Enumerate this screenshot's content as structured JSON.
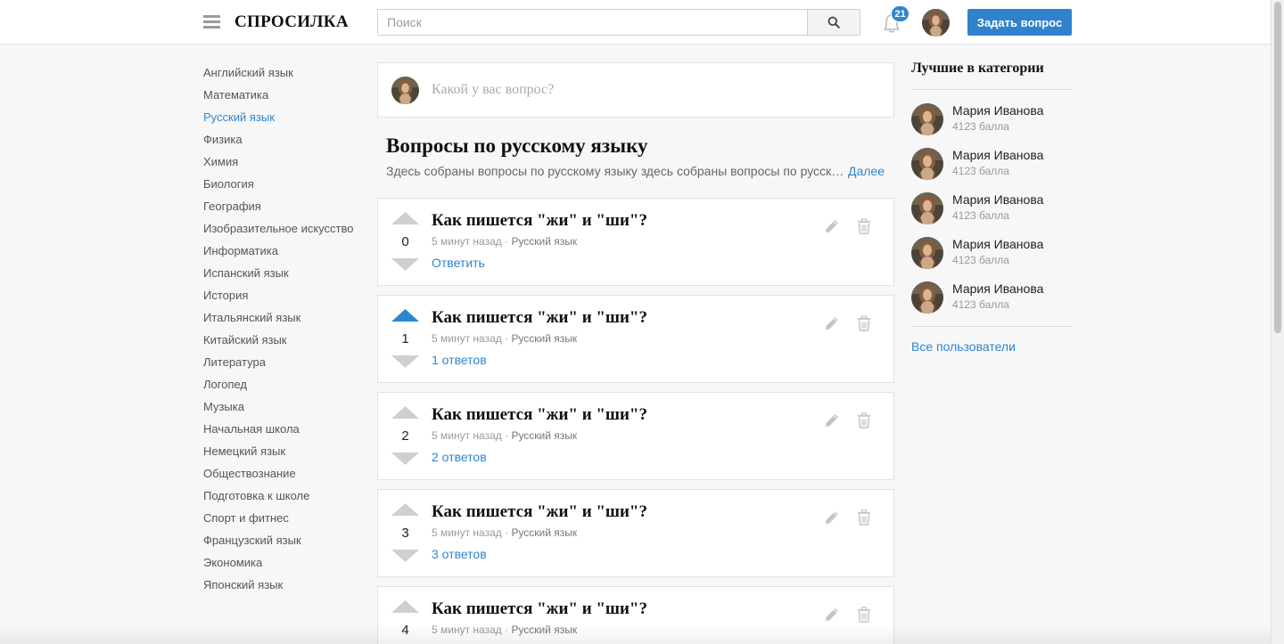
{
  "header": {
    "logo": "СПРОСИЛКА",
    "search_placeholder": "Поиск",
    "notification_count": "21",
    "ask_button": "Задать вопрос"
  },
  "categories": [
    {
      "label": "Английский язык"
    },
    {
      "label": "Математика"
    },
    {
      "label": "Русский язык",
      "active": true
    },
    {
      "label": "Физика"
    },
    {
      "label": "Химия"
    },
    {
      "label": "Биология"
    },
    {
      "label": "География"
    },
    {
      "label": "Изобразительное искусство"
    },
    {
      "label": "Информатика"
    },
    {
      "label": "Испанский язык"
    },
    {
      "label": "История"
    },
    {
      "label": "Итальянский язык"
    },
    {
      "label": "Китайский язык"
    },
    {
      "label": "Литература"
    },
    {
      "label": "Логопед"
    },
    {
      "label": "Музыка"
    },
    {
      "label": "Начальная школа"
    },
    {
      "label": "Немецкий язык"
    },
    {
      "label": "Обществознание"
    },
    {
      "label": "Подготовка к школе"
    },
    {
      "label": "Спорт и фитнес"
    },
    {
      "label": "Французский язык"
    },
    {
      "label": "Экономика"
    },
    {
      "label": "Японский язык"
    }
  ],
  "composer": {
    "placeholder": "Какой у вас вопрос?"
  },
  "main": {
    "title": "Вопросы по русскому языку",
    "description": "Здесь собраны вопросы по русскому языку здесь собраны вопросы по русскому языку",
    "more_link": "Далее"
  },
  "questions": [
    {
      "votes": "0",
      "upvoted": false,
      "title": "Как пишется \"жи\" и \"ши\"?",
      "time": "5 минут назад",
      "category": "Русский язык",
      "answer_link": "Ответить"
    },
    {
      "votes": "1",
      "upvoted": true,
      "title": "Как пишется \"жи\" и \"ши\"?",
      "time": "5 минут назад",
      "category": "Русский язык",
      "answer_link": "1 ответов"
    },
    {
      "votes": "2",
      "upvoted": false,
      "title": "Как пишется \"жи\" и \"ши\"?",
      "time": "5 минут назад",
      "category": "Русский язык",
      "answer_link": "2 ответов"
    },
    {
      "votes": "3",
      "upvoted": false,
      "title": "Как пишется \"жи\" и \"ши\"?",
      "time": "5 минут назад",
      "category": "Русский язык",
      "answer_link": "3 ответов"
    },
    {
      "votes": "4",
      "upvoted": false,
      "title": "Как пишется \"жи\" и \"ши\"?",
      "time": "5 минут назад",
      "category": "Русский язык",
      "answer_link": ""
    }
  ],
  "sidebar_right": {
    "title": "Лучшие в категории",
    "users": [
      {
        "name": "Мария Иванова",
        "points": "4123 балла"
      },
      {
        "name": "Мария Иванова",
        "points": "4123 балла"
      },
      {
        "name": "Мария Иванова",
        "points": "4123 балла"
      },
      {
        "name": "Мария Иванова",
        "points": "4123 балла"
      },
      {
        "name": "Мария Иванова",
        "points": "4123 балла"
      }
    ],
    "all_users_link": "Все пользователи"
  },
  "colors": {
    "accent": "#2d86cf",
    "button": "#3182cd",
    "vote_inactive": "#cfcfcf",
    "icon_gray": "#c4c4c4"
  },
  "icons": {
    "menu": "hamburger-icon",
    "search": "search-icon",
    "notifications": "bell-icon",
    "vote_up": "arrow-up-icon",
    "vote_down": "arrow-down-icon",
    "edit": "pencil-icon",
    "delete": "trash-icon"
  }
}
